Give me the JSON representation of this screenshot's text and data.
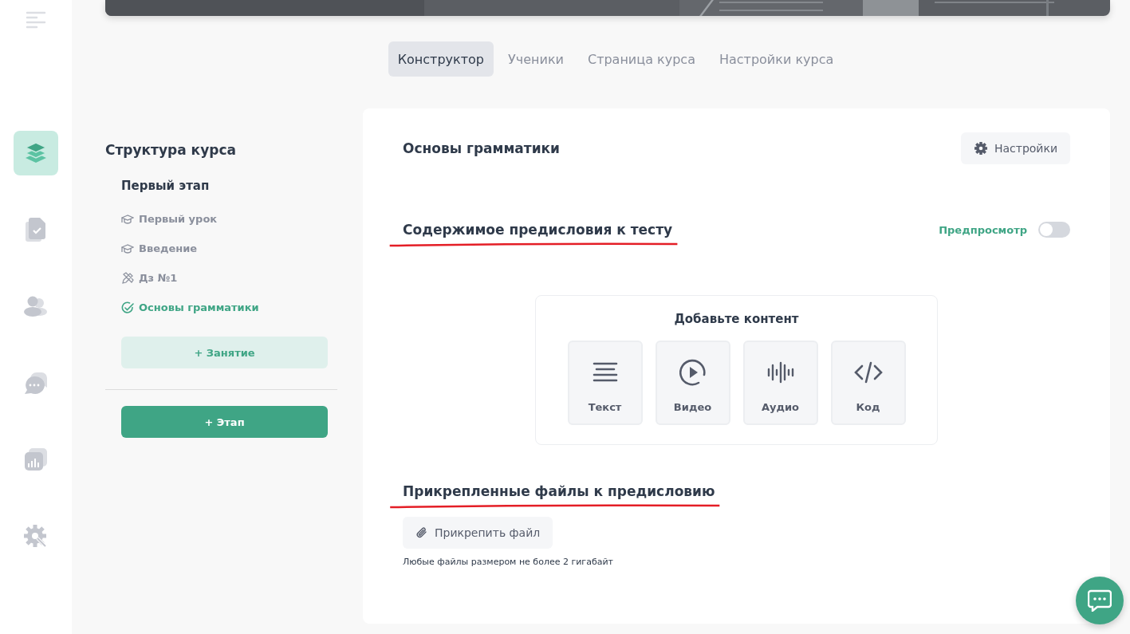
{
  "nav_rail": {
    "items": [
      {
        "kind": "layers",
        "selected": true
      },
      {
        "kind": "document",
        "selected": false
      },
      {
        "kind": "users",
        "selected": false
      },
      {
        "kind": "chat",
        "selected": false
      },
      {
        "kind": "chart",
        "selected": false
      },
      {
        "kind": "settings",
        "selected": false
      }
    ]
  },
  "tabs": [
    {
      "label": "Конструктор",
      "selected": true
    },
    {
      "label": "Ученики",
      "selected": false
    },
    {
      "label": "Страница курса",
      "selected": false
    },
    {
      "label": "Настройки курса",
      "selected": false
    }
  ],
  "structure": {
    "title": "Структура курса",
    "stage": "Первый этап",
    "lessons": [
      {
        "label": "Первый урок",
        "kind": "lesson",
        "selected": false
      },
      {
        "label": "Введение",
        "kind": "lesson",
        "selected": false
      },
      {
        "label": "Дз №1",
        "kind": "homework",
        "selected": false
      },
      {
        "label": "Основы грамматики",
        "kind": "test",
        "selected": true
      }
    ],
    "add_lesson": "+ Занятие",
    "add_stage": "+ Этап"
  },
  "editor": {
    "title": "Основы грамматики",
    "settings_button": "Настройки",
    "intro": {
      "heading": "Содержимое предисловия к тесту",
      "underlined": true,
      "preview": {
        "label": "Предпросмотр",
        "on": false
      }
    },
    "add_content": {
      "title": "Добавьте контент",
      "options": [
        {
          "kind": "text",
          "label": "Текст"
        },
        {
          "kind": "video",
          "label": "Видео"
        },
        {
          "kind": "audio",
          "label": "Аудио"
        },
        {
          "kind": "code",
          "label": "Код"
        }
      ]
    },
    "attachments": {
      "heading": "Прикрепленные файлы к предисловию",
      "underlined": true,
      "button": "Прикрепить файл",
      "hint": "Любые файлы размером не более 2 гигабайт"
    }
  }
}
